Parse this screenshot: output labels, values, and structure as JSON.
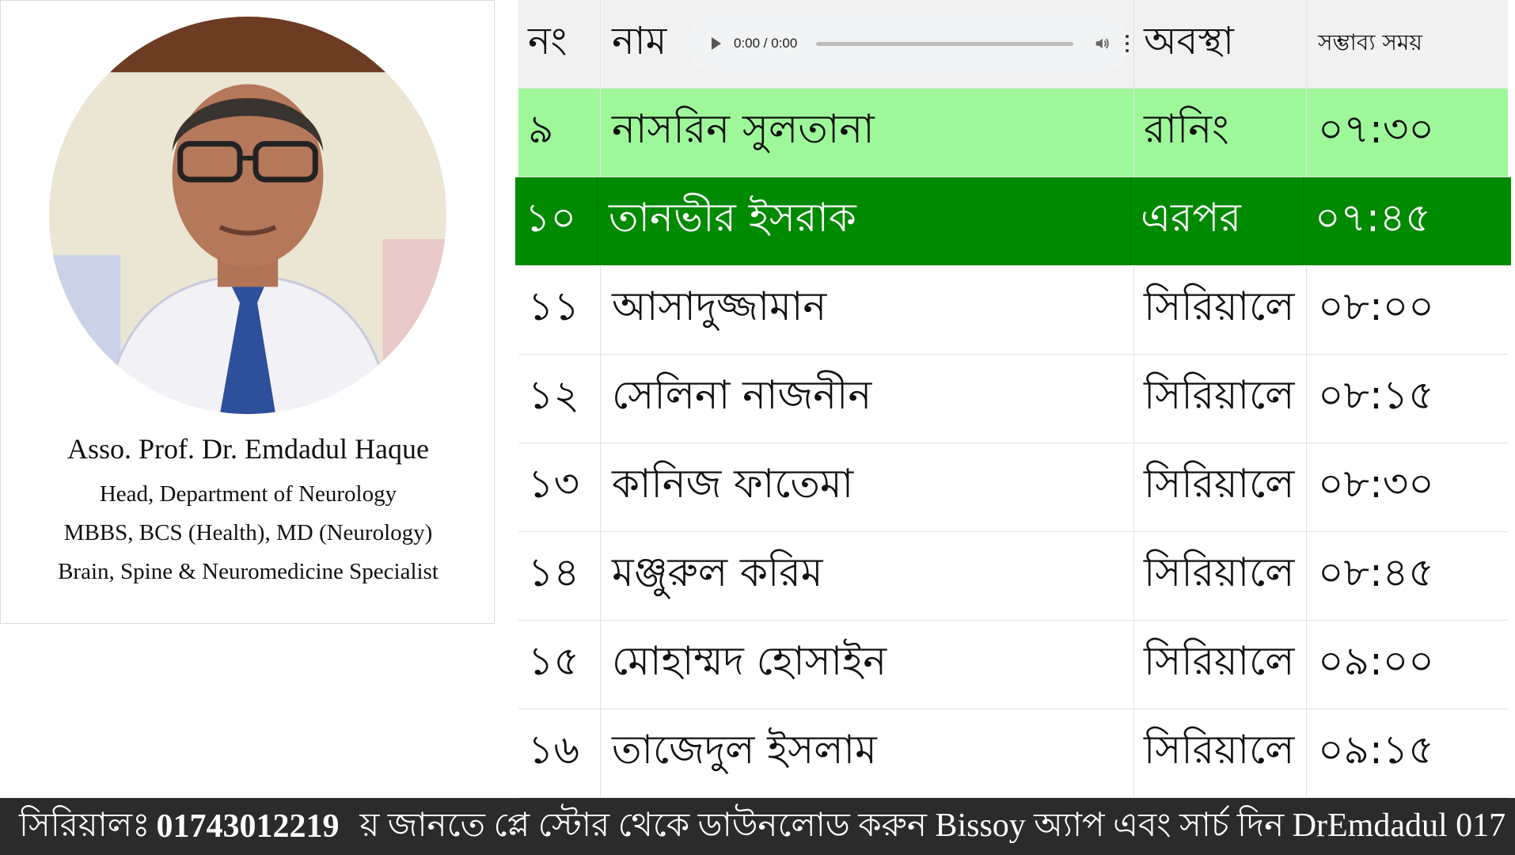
{
  "doctor": {
    "name": "Asso. Prof. Dr. Emdadul Haque",
    "lines": [
      "Head, Department of Neurology",
      "MBBS, BCS (Health), MD (Neurology)",
      "Brain, Spine & Neuromedicine Specialist"
    ]
  },
  "table": {
    "headers": {
      "no": "নং",
      "name": "নাম",
      "status": "অবস্থা",
      "time": "সম্ভাব্য সময়"
    },
    "audio": {
      "time": "0:00 / 0:00"
    },
    "rows": [
      {
        "no": "৯",
        "name": "নাসরিন সুলতানা",
        "status": "রানিং",
        "time": "০৭:৩০"
      },
      {
        "no": "১০",
        "name": "তানভীর ইসরাক",
        "status": "এরপর",
        "time": "০৭:৪৫"
      },
      {
        "no": "১১",
        "name": "আসাদুজ্জামান",
        "status": "সিরিয়ালে",
        "time": "০৮:০০"
      },
      {
        "no": "১২",
        "name": "সেলিনা নাজনীন",
        "status": "সিরিয়ালে",
        "time": "০৮:১৫"
      },
      {
        "no": "১৩",
        "name": "কানিজ ফাতেমা",
        "status": "সিরিয়ালে",
        "time": "০৮:৩০"
      },
      {
        "no": "১৪",
        "name": "মঞ্জুরুল করিম",
        "status": "সিরিয়ালে",
        "time": "০৮:৪৫"
      },
      {
        "no": "১৫",
        "name": "মোহাম্মদ হোসাইন",
        "status": "সিরিয়ালে",
        "time": "০৯:০০"
      },
      {
        "no": "১৬",
        "name": "তাজেদুল ইসলাম",
        "status": "সিরিয়ালে",
        "time": "০৯:১৫"
      }
    ]
  },
  "ticker": {
    "label": "সিরিয়ালঃ",
    "phone": "01743012219",
    "message": "য় জানতে প্লে স্টোর থেকে ডাউনলোড করুন Bissoy অ্যাপ এবং সার্চ দিন DrEmdadul 017"
  },
  "colors": {
    "running": "#9ef89a",
    "next": "#008a00",
    "ticker_bg": "#2b2b2b"
  }
}
